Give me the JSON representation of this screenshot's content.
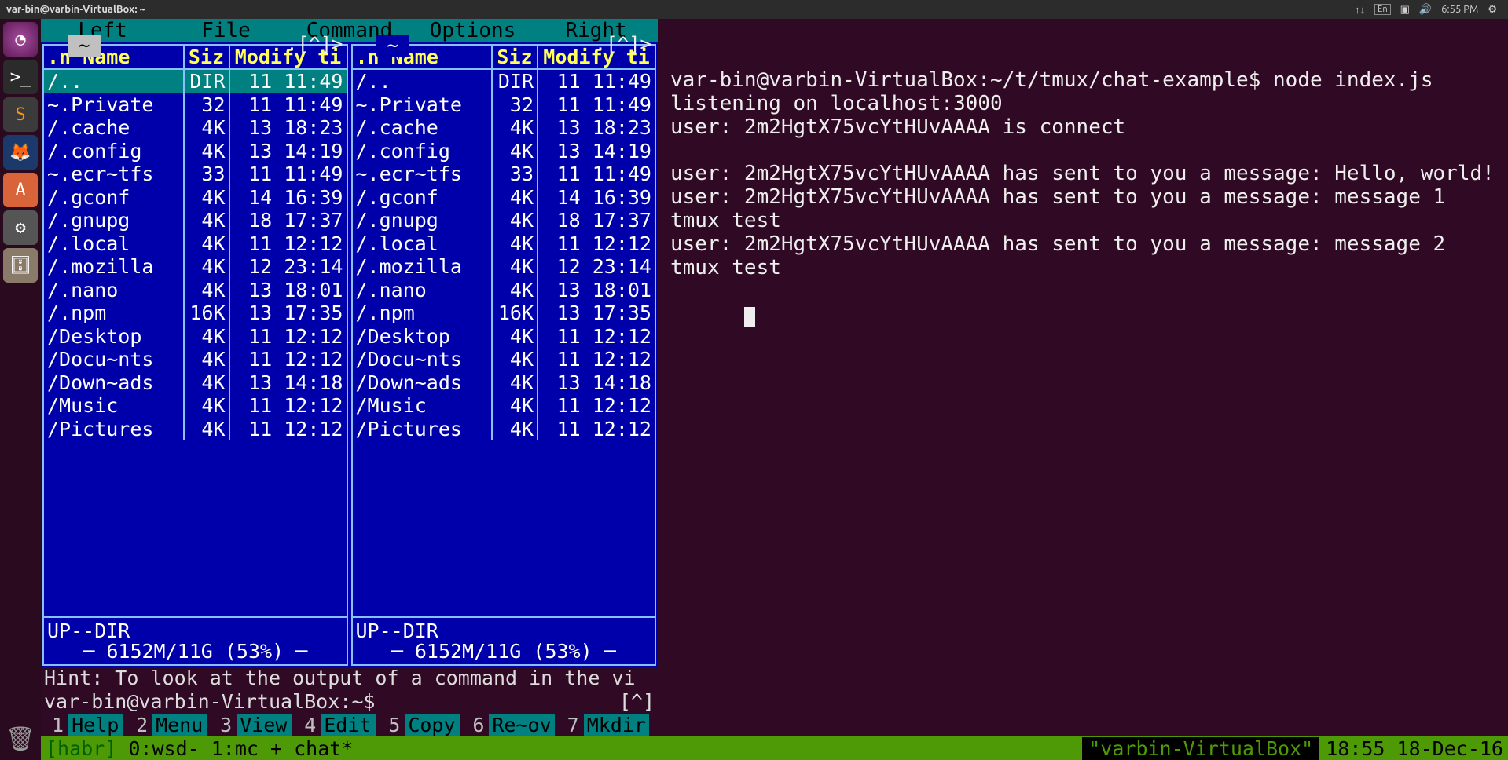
{
  "top_panel": {
    "title": "var-bin@varbin-VirtualBox: ~",
    "lang": "En",
    "time": "6:55 PM"
  },
  "mc": {
    "menu": [
      "Left",
      "File",
      "Command",
      "Options",
      "Right"
    ],
    "path": "~",
    "header_buttons": ".[^]>",
    "columns": {
      "n": ".n",
      "name": "Name",
      "size": "Siz",
      "mod": "Modify ti"
    },
    "rows": [
      {
        "name": "/..",
        "size": "DIR",
        "mod": "11 11:49",
        "sel": true
      },
      {
        "name": "~.Private",
        "size": "32",
        "mod": "11 11:49"
      },
      {
        "name": "/.cache",
        "size": "4K",
        "mod": "13 18:23"
      },
      {
        "name": "/.config",
        "size": "4K",
        "mod": "13 14:19"
      },
      {
        "name": "~.ecr~tfs",
        "size": "33",
        "mod": "11 11:49"
      },
      {
        "name": "/.gconf",
        "size": "4K",
        "mod": "14 16:39"
      },
      {
        "name": "/.gnupg",
        "size": "4K",
        "mod": "18 17:37"
      },
      {
        "name": "/.local",
        "size": "4K",
        "mod": "11 12:12"
      },
      {
        "name": "/.mozilla",
        "size": "4K",
        "mod": "12 23:14"
      },
      {
        "name": "/.nano",
        "size": "4K",
        "mod": "13 18:01"
      },
      {
        "name": "/.npm",
        "size": "16K",
        "mod": "13 17:35"
      },
      {
        "name": "/Desktop",
        "size": "4K",
        "mod": "11 12:12"
      },
      {
        "name": "/Docu~nts",
        "size": "4K",
        "mod": "11 12:12"
      },
      {
        "name": "/Down~ads",
        "size": "4K",
        "mod": "13 14:18"
      },
      {
        "name": "/Music",
        "size": "4K",
        "mod": "11 12:12"
      },
      {
        "name": "/Pictures",
        "size": "4K",
        "mod": "11 12:12"
      }
    ],
    "footer": "UP--DIR",
    "disk": "─ 6152M/11G (53%) ─",
    "hint": "Hint: To look at the output of a command in the vi",
    "prompt": "var-bin@varbin-VirtualBox:~$",
    "prompt_ctrl": "[^]",
    "fkeys": [
      {
        "n": "1",
        "l": "Help"
      },
      {
        "n": "2",
        "l": "Menu"
      },
      {
        "n": "3",
        "l": "View"
      },
      {
        "n": "4",
        "l": "Edit"
      },
      {
        "n": "5",
        "l": "Copy"
      },
      {
        "n": "6",
        "l": "Re~ov"
      },
      {
        "n": "7",
        "l": "Mkdir"
      }
    ]
  },
  "term": {
    "lines": [
      "var-bin@varbin-VirtualBox:~/t/tmux/chat-example$ node index.js",
      "listening on localhost:3000",
      "user: 2m2HgtX75vcYtHUvAAAA is connect",
      "",
      "user: 2m2HgtX75vcYtHUvAAAA has sent to you a message: Hello, world!",
      "user: 2m2HgtX75vcYtHUvAAAA has sent to you a message: message 1 tmux test",
      "user: 2m2HgtX75vcYtHUvAAAA has sent to you a message: message 2 tmux test"
    ]
  },
  "tmux": {
    "session": "[habr]",
    "windows": "0:wsd- 1:mc + chat*",
    "host": "\"varbin-VirtualBox\"",
    "time": "18:55 18-Dec-16"
  }
}
